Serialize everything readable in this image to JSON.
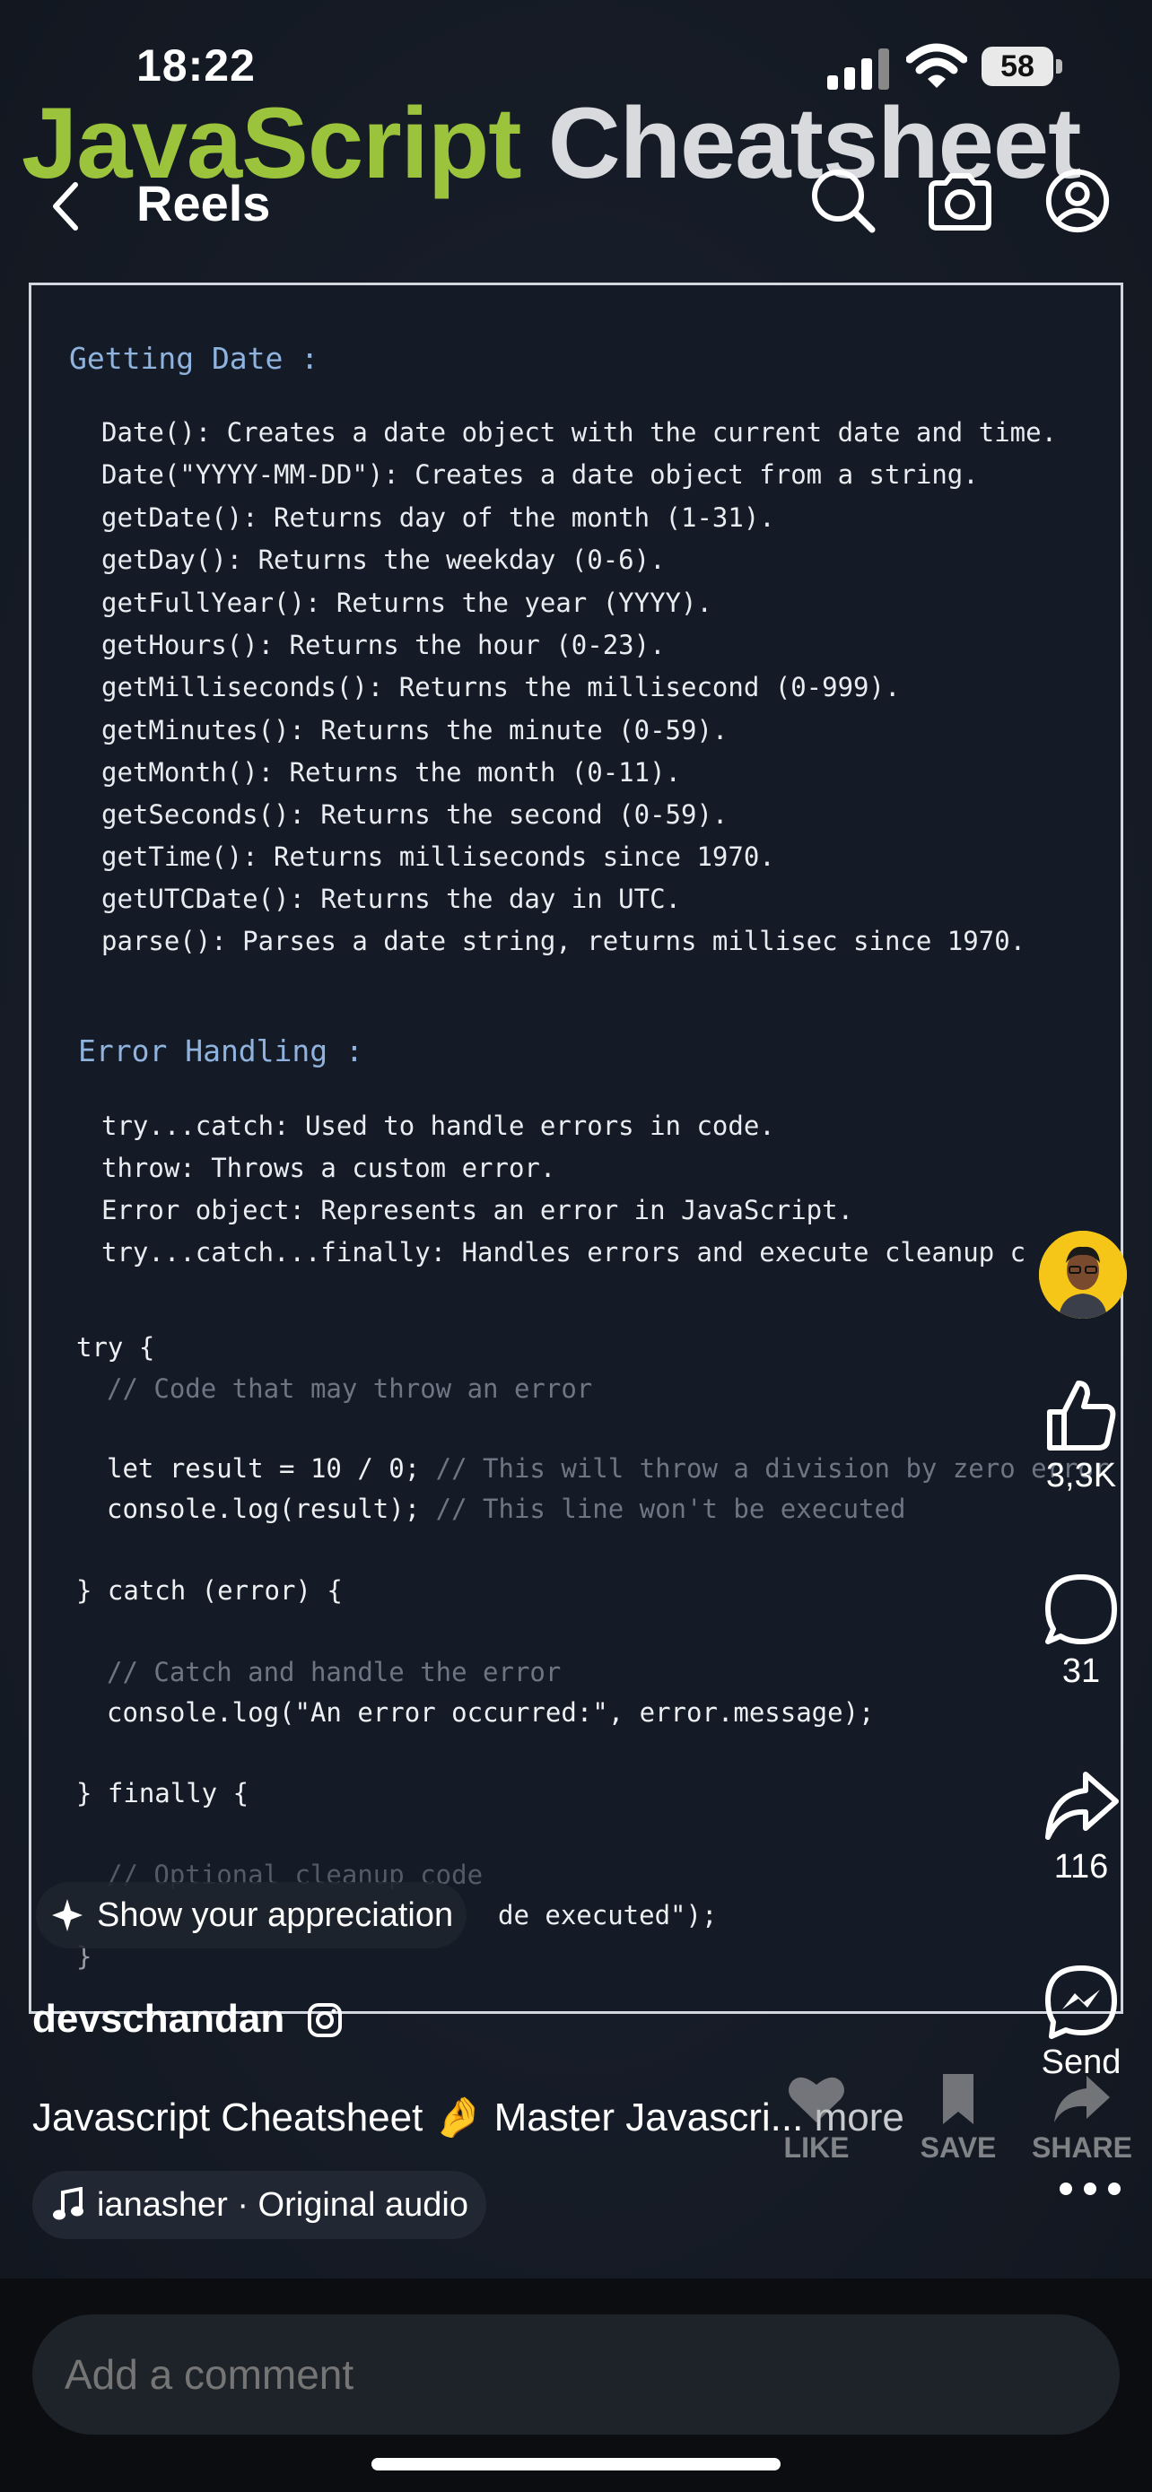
{
  "status_bar": {
    "time": "18:22",
    "battery": "58"
  },
  "video_title": {
    "part1": "JavaScript",
    "part2": "Cheatsheet"
  },
  "nav": {
    "title": "Reels"
  },
  "code": {
    "section1_heading": "Getting Date :",
    "section1_lines": [
      "Date(): Creates a date object with the current date and time.",
      "Date(\"YYYY-MM-DD\"): Creates a date object from a string.",
      "getDate(): Returns day of the month (1-31).",
      "getDay(): Returns the weekday (0-6).",
      "getFullYear(): Returns the year (YYYY).",
      "getHours(): Returns the hour (0-23).",
      "getMilliseconds(): Returns the millisecond (0-999).",
      "getMinutes(): Returns the minute (0-59).",
      "getMonth(): Returns the month (0-11).",
      "getSeconds(): Returns the second (0-59).",
      "getTime(): Returns milliseconds since 1970.",
      "getUTCDate(): Returns the day in UTC.",
      "parse(): Parses a date string, returns millisec since 1970."
    ],
    "section2_heading": "Error Handling :",
    "section2_lines": [
      "try...catch: Used to handle errors in code.",
      "throw: Throws a custom error.",
      "Error object: Represents an error in JavaScript.",
      "try...catch...finally: Handles errors and execute cleanup c"
    ],
    "example": {
      "try_open": "try {",
      "comment1": "// Code that may throw an error",
      "let_code": "let result = 10 / 0;",
      "let_comment": " // This will throw a division by zero error",
      "log_code": "console.log(result);",
      "log_comment": " // This line won't be executed",
      "catch_open": "} catch (error) {",
      "comment2": "// Catch and handle the error",
      "log_error": "console.log(\"An error occurred:\", error.message);",
      "finally_open": "} finally {",
      "comment3": "// Optional cleanup code",
      "log_finally_tail": "de executed\");",
      "close": "}"
    }
  },
  "appreciation": {
    "label": "Show your appreciation"
  },
  "author": {
    "name": "devschandan"
  },
  "caption": {
    "text": "Javascript Cheatsheet",
    "emoji": "🤌",
    "text2": "Master Javascri...",
    "more": "more"
  },
  "audio": {
    "label": "ianasher · Original audio"
  },
  "overlay_actions": {
    "like": "LIKE",
    "save": "SAVE",
    "share": "SHARE"
  },
  "rail": {
    "likes": "3,3K",
    "comments": "31",
    "shares": "116",
    "send": "Send"
  },
  "comment": {
    "placeholder": "Add a comment"
  }
}
